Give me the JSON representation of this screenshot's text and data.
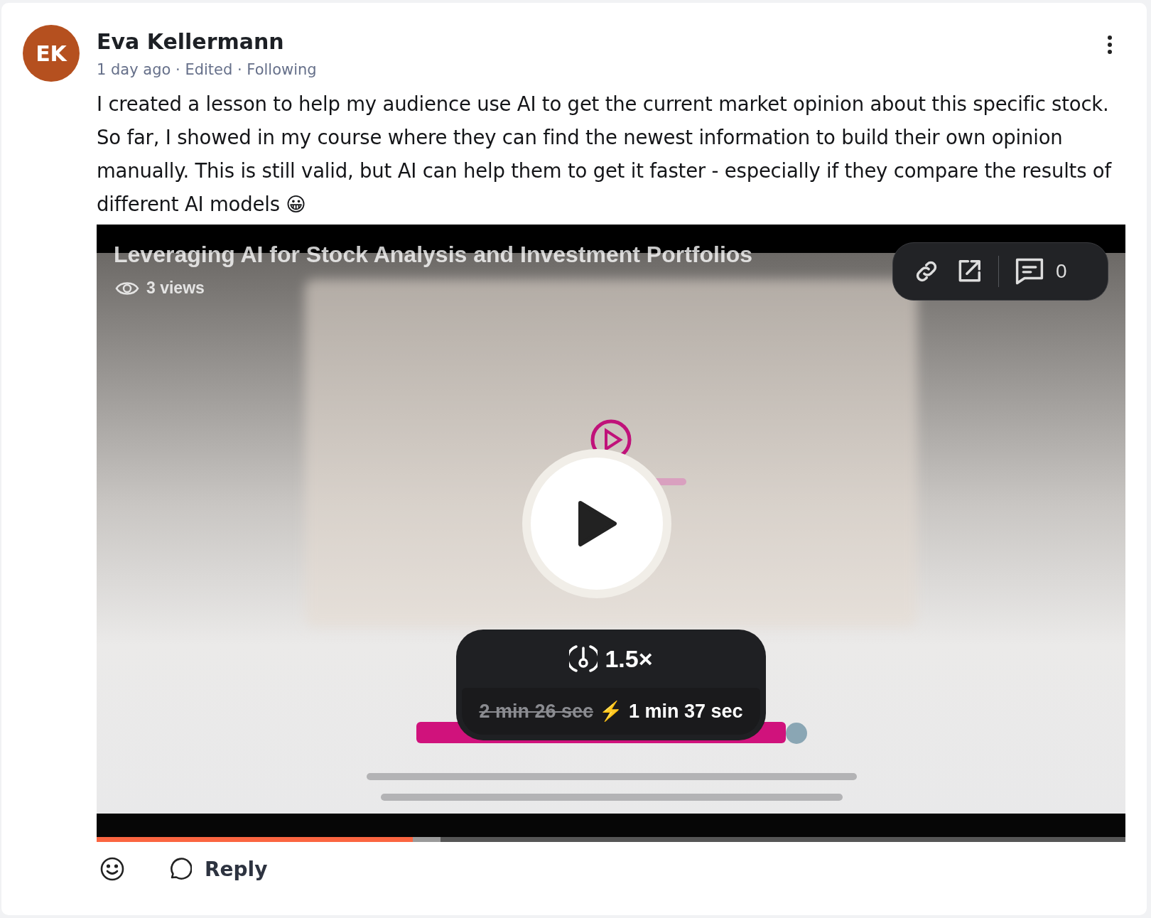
{
  "author": {
    "initials": "EK",
    "name": "Eva Kellermann",
    "meta": "1 day ago · Edited · Following"
  },
  "body": "I created a lesson to help my audience use AI to get the current market opinion about this specific stock. So far, I showed in my course where they can find the newest information to build their own opinion manually. This is still valid, but AI can help them to get it faster -  especially if they compare the results of different AI models 😀",
  "video": {
    "title": "Leveraging AI for Stock Analysis and Investment Portfolios",
    "views": "3 views",
    "comment_count": "0",
    "speed": "1.5×",
    "original_duration": "2 min 26 sec",
    "bolt": "⚡",
    "fast_duration": "1 min 37 sec",
    "progress": {
      "level": 0.307
    },
    "buffered": {
      "level": 0.334
    }
  },
  "actions": {
    "reply": "Reply"
  }
}
